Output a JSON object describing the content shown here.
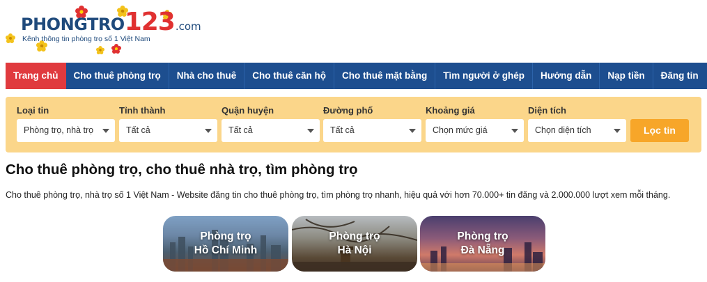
{
  "logo": {
    "word_part1": "PHONGTRO",
    "word_part2": "123",
    "word_part3": ".com",
    "tagline": "Kênh thông tin phòng trọ số 1 Việt Nam"
  },
  "nav": {
    "items": [
      {
        "label": "Trang chủ",
        "active": true
      },
      {
        "label": "Cho thuê phòng trọ"
      },
      {
        "label": "Nhà cho thuê"
      },
      {
        "label": "Cho thuê căn hộ"
      },
      {
        "label": "Cho thuê mặt bằng"
      },
      {
        "label": "Tìm người ở ghép"
      },
      {
        "label": "Hướng dẫn"
      },
      {
        "label": "Nạp tiền"
      },
      {
        "label": "Đăng tin"
      }
    ]
  },
  "filter": {
    "fields": [
      {
        "label": "Loại tin",
        "value": "Phòng trọ, nhà trọ"
      },
      {
        "label": "Tỉnh thành",
        "value": "Tất cả"
      },
      {
        "label": "Quận huyện",
        "value": "Tất cả"
      },
      {
        "label": "Đường phố",
        "value": "Tất cả"
      },
      {
        "label": "Khoảng giá",
        "value": "Chọn mức giá"
      },
      {
        "label": "Diện tích",
        "value": "Chọn diện tích"
      }
    ],
    "button_label": "Lọc tin"
  },
  "content": {
    "title": "Cho thuê phòng trọ, cho thuê nhà trọ, tìm phòng trọ",
    "description": "Cho thuê phòng trọ, nhà trọ số 1 Việt Nam - Website đăng tin cho thuê phòng trọ, tìm phòng trọ nhanh, hiệu quả với hơn 70.000+ tin đăng và 2.000.000 lượt xem mỗi tháng."
  },
  "cities": [
    {
      "line1": "Phòng trọ",
      "line2": "Hồ Chí Minh"
    },
    {
      "line1": "Phòng trọ",
      "line2": "Hà Nội"
    },
    {
      "line1": "Phòng trọ",
      "line2": "Đà Nẵng"
    }
  ],
  "colors": {
    "nav_bg": "#1d4e8f",
    "nav_active": "#e03a3e",
    "filter_bg": "#fbd68a",
    "filter_button": "#f7a629",
    "logo_blue": "#1f4a7c",
    "logo_red": "#e03131"
  }
}
